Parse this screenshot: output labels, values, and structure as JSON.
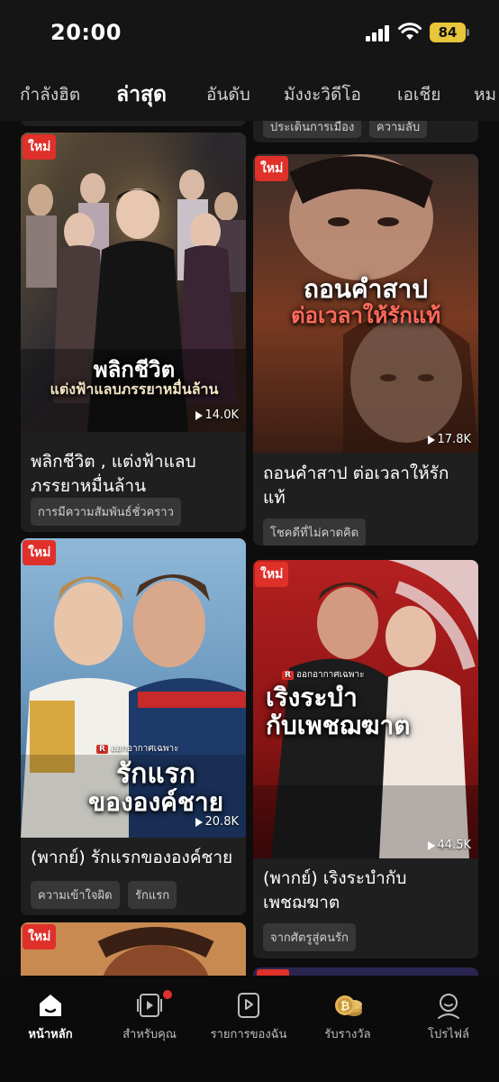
{
  "status": {
    "time": "20:00",
    "battery": "84"
  },
  "tabs": [
    {
      "label": "กำลังฮิต"
    },
    {
      "label": "ล่าสุด",
      "active": true
    },
    {
      "label": "อันดับ"
    },
    {
      "label": "มังงะวิดีโอ"
    },
    {
      "label": "เอเชีย"
    },
    {
      "label": "หม"
    }
  ],
  "partial_top": {
    "tags": [
      "ประเด็นการเมือง",
      "ความลับ"
    ]
  },
  "cards": [
    {
      "badge": "ใหม่",
      "poster_title_line1": "พลิกชีวิต",
      "poster_title_line2": "แต่งฟ้าแลบภรรยาหมื่นล้าน",
      "views": "14.0K",
      "title": "พลิกชีวิต , แต่งฟ้าแลบภรรยาหมื่นล้าน",
      "tags": [
        "การมีความสัมพันธ์ชั่วคราว"
      ]
    },
    {
      "badge": "ใหม่",
      "poster_title_line1": "ถอนคำสาป",
      "poster_title_line2": "ต่อเวลาให้รักแท้",
      "views": "17.8K",
      "title": "ถอนคำสาป ต่อเวลาให้รักแท้",
      "tags": [
        "โชคดีที่ไม่คาดคิด"
      ]
    },
    {
      "badge": "ใหม่",
      "poster_brand": "ออกอากาศเฉพาะ",
      "poster_title_line1": "รักแรก",
      "poster_title_line2": "ขององค์ชาย",
      "views": "20.8K",
      "title": "(พากย์) รักแรกขององค์ชาย",
      "tags": [
        "ความเข้าใจผิด",
        "รักแรก"
      ]
    },
    {
      "badge": "ใหม่",
      "poster_brand": "ออกอากาศเฉพาะ",
      "poster_title_line1": "เริงระบำ",
      "poster_title_line2": "กับเพชฌฆาต",
      "views": "44.5K",
      "title": "(พากย์) เริงระบำกับเพชฌฆาต",
      "tags": [
        "จากศัตรูสู่คนรัก"
      ]
    },
    {
      "badge": "ใหม่"
    }
  ],
  "nav": [
    {
      "label": "หน้าหลัก",
      "icon": "home-icon",
      "active": true
    },
    {
      "label": "สำหรับคุณ",
      "icon": "video-icon"
    },
    {
      "label": "รายการของฉัน",
      "icon": "playlist-icon"
    },
    {
      "label": "รับรางวัล",
      "icon": "coins-icon"
    },
    {
      "label": "โปรไฟล์",
      "icon": "profile-icon"
    }
  ],
  "colors": {
    "accent": "#e0302a",
    "background": "#0d0d0d",
    "card": "#1f1f1f",
    "battery": "#e8c53a"
  }
}
